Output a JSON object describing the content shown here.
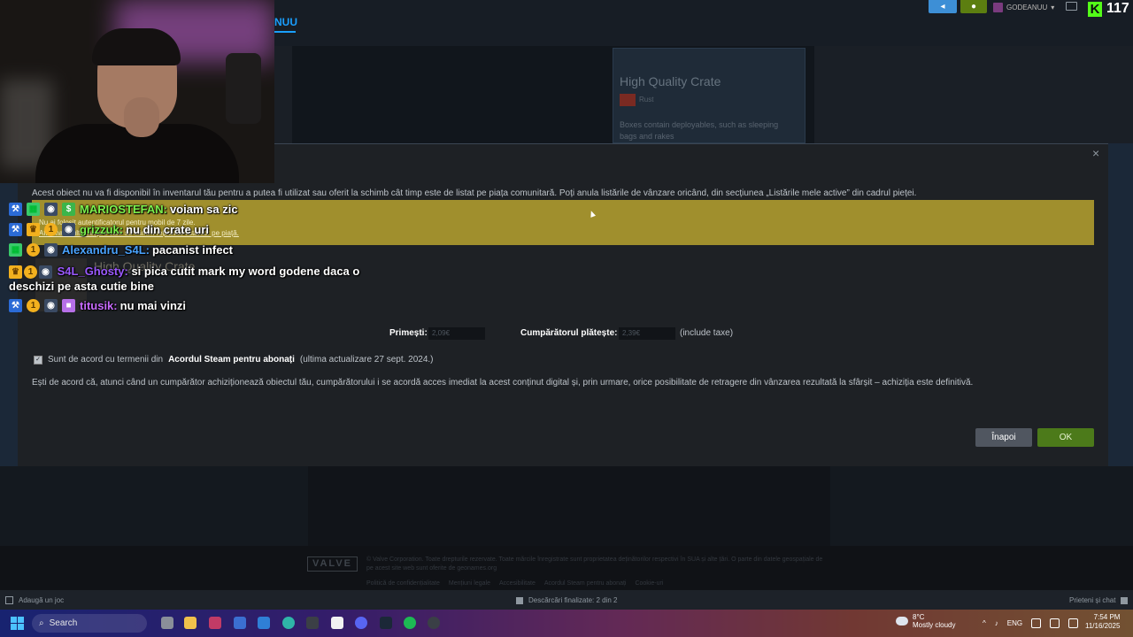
{
  "stream": {
    "viewer_count": "117",
    "kick_logo_letter": "K"
  },
  "steam": {
    "menu_tab": "NUU",
    "username": "GODEANUU",
    "crate": {
      "title": "High Quality Crate",
      "subtitle": "Rust",
      "description": "Boxes contain deployables, such as sleeping bags and rakes"
    },
    "footer": {
      "valve": "VALVE",
      "copyright": "© Valve Corporation. Toate drepturile rezervate. Toate mărcile înregistrate sunt proprietatea deținătorilor respectivi în SUA și alte țări. O parte din datele geospațiale de pe acest site web sunt oferite de geonames.org",
      "links": [
        "Politică de confidențialitate",
        "Mențiuni legale",
        "Accesibilitate",
        "Acordul Steam pentru abonați",
        "Cookie-uri"
      ]
    },
    "bottombar": {
      "add_game": "Adaugă un joc",
      "downloads": "Descărcări finalizate: 2 din 2",
      "friends": "Prieteni și chat"
    }
  },
  "dialog": {
    "close": "×",
    "notice": "Acest obiect nu va fi disponibil în inventarul tău pentru a putea fi utilizat sau oferit la schimb cât timp este de listat pe piața comunitară. Poți anula listările de vânzare oricând, din secțiunea „Listările mele active” din cadrul pieței.",
    "warning_line1": "Nu ai folosit autentificatorul pentru mobil de 7 zile.",
    "warning_line2": "Află mai multe despre cum să elimini reținerile listărilor pe piață.",
    "item_name": "High Quality Crate",
    "receive_label": "Primești:",
    "receive_value": "2,09€",
    "buyer_label": "Cumpărătorul plătește:",
    "buyer_value": "2,39€",
    "tax_note": "(include taxe)",
    "agree_prefix": "Sunt de acord cu termenii din",
    "agree_link": "Acordul Steam pentru abonați",
    "agree_suffix": "(ultima actualizare 27 sept. 2024.)",
    "legal": "Ești de acord că, atunci când un cumpărător achiziționează obiectul tău, cumpărătorului i se acordă acces imediat la acest conținut digital și, prin urmare, orice posibilitate de retragere din vânzarea rezultată la sfârșit – achiziția este definitivă.",
    "back_button": "Înapoi",
    "ok_button": "OK"
  },
  "chat": [
    {
      "user": "MARIOSTEFAN:",
      "text": "voiam sa zic",
      "color": "#7cf24c"
    },
    {
      "user": "grizzuk:",
      "text": "nu din crate uri",
      "color": "#7cf24c"
    },
    {
      "user": "Alexandru_S4L:",
      "text": "pacanist infect",
      "color": "#4aa3ff"
    },
    {
      "user": "S4L_Ghosty:",
      "text": "si pica cutit mark my word godene daca o deschizi pe asta cutie bine",
      "color": "#9b59ff"
    },
    {
      "user": "titusik:",
      "text": "nu mai vinzi",
      "color": "#c86bff"
    }
  ],
  "taskbar": {
    "search": "Search",
    "weather_temp": "8°C",
    "weather_desc": "Mostly cloudy",
    "language": "ENG",
    "time": "7:54 PM",
    "date": "11/16/2025"
  }
}
